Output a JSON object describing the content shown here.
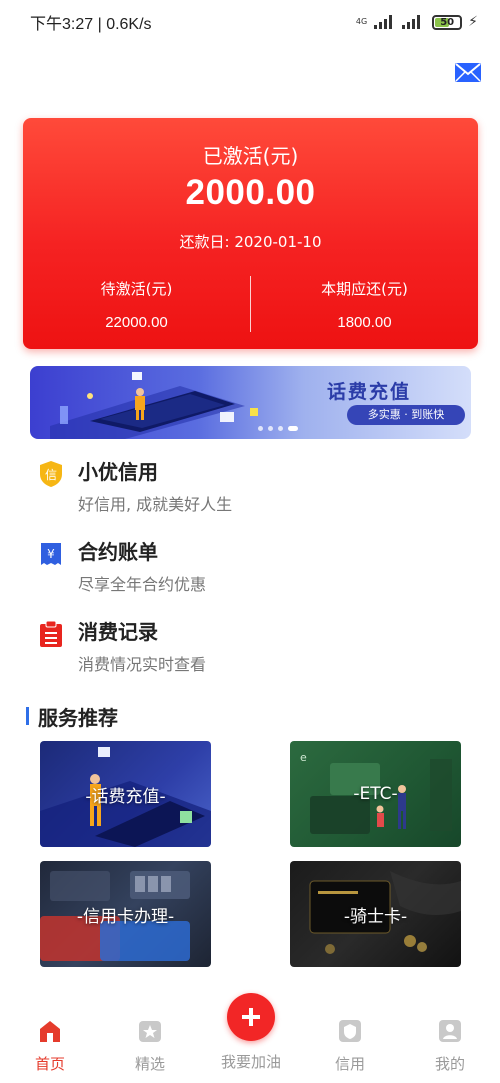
{
  "status_bar": {
    "time_speed": "下午3:27 | 0.6K/s",
    "network": "4G",
    "battery": "50"
  },
  "summary_card": {
    "activated_label": "已激活(元)",
    "activated_amount": "2000.00",
    "due_date_text": "还款日: 2020-01-10",
    "pending_label": "待激活(元)",
    "pending_value": "22000.00",
    "payable_label": "本期应还(元)",
    "payable_value": "1800.00"
  },
  "banner": {
    "title": "话费充值",
    "subtitle": "多实惠 · 到账快",
    "pages": 4,
    "active_page": 4
  },
  "features": [
    {
      "title": "小优信用",
      "subtitle": "好信用, 成就美好人生",
      "icon": "shield-credit-icon"
    },
    {
      "title": "合约账单",
      "subtitle": "尽享全年合约优惠",
      "icon": "bill-yen-icon"
    },
    {
      "title": "消费记录",
      "subtitle": "消费情况实时查看",
      "icon": "clipboard-list-icon"
    }
  ],
  "services_section": {
    "title": "服务推荐",
    "accent_color": "#2f6fe8",
    "tiles": [
      {
        "label": "-话费充值-"
      },
      {
        "label": "-ETC-"
      },
      {
        "label": "-信用卡办理-"
      },
      {
        "label": "-骑士卡-"
      }
    ]
  },
  "tabbar": {
    "tabs": [
      {
        "label": "首页",
        "icon": "home-icon",
        "active": true
      },
      {
        "label": "精选",
        "icon": "featured-icon",
        "active": false
      },
      {
        "label": "我要加油",
        "icon": "plus-icon",
        "active": false
      },
      {
        "label": "信用",
        "icon": "credit-icon",
        "active": false
      },
      {
        "label": "我的",
        "icon": "profile-icon",
        "active": false
      }
    ]
  },
  "colors": {
    "primary_red": "#f22626",
    "tab_active": "#e53b2c",
    "mail_icon": "#2962ff"
  }
}
